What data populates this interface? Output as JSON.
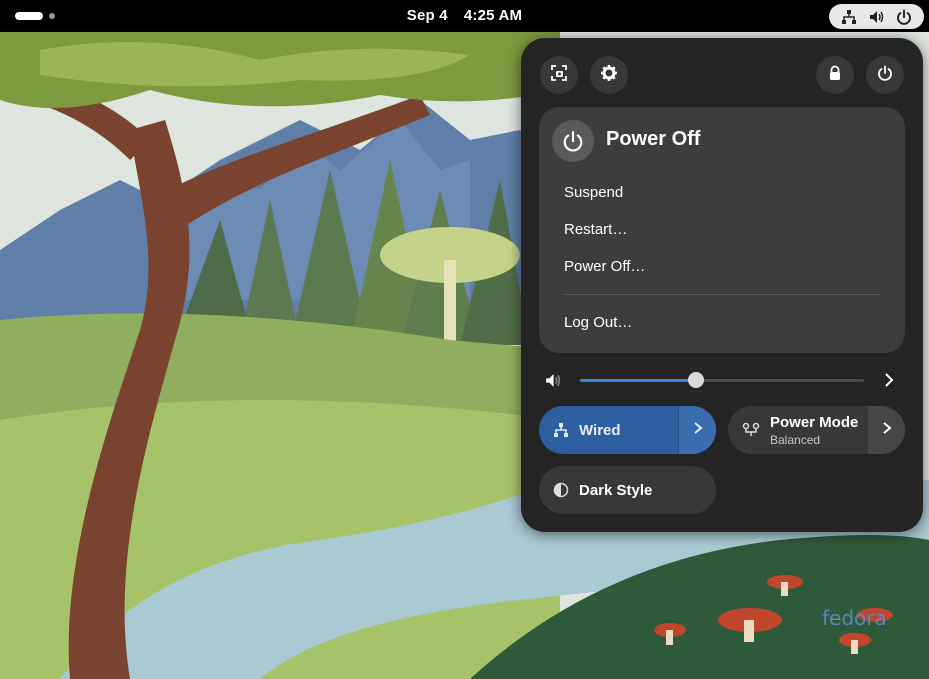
{
  "topbar": {
    "date": "Sep 4",
    "time": "4:25 AM",
    "tray_icons": [
      "network-wired-icon",
      "volume-icon",
      "power-icon"
    ]
  },
  "panel": {
    "header_buttons": {
      "left": [
        "screenshot-icon",
        "settings-gear-icon"
      ],
      "right": [
        "lock-icon",
        "power-icon"
      ]
    },
    "power_menu": {
      "title": "Power Off",
      "items": [
        "Suspend",
        "Restart…",
        "Power Off…"
      ],
      "logout": "Log Out…"
    },
    "volume": {
      "level": 0.41
    },
    "toggles": {
      "wired": {
        "label": "Wired",
        "active": true
      },
      "power_mode": {
        "label": "Power Mode",
        "subtitle": "Balanced",
        "active": false
      },
      "dark_style": {
        "label": "Dark Style",
        "active": false
      }
    }
  },
  "wallpaper": {
    "logo_text": "fedora"
  },
  "colors": {
    "accent": "#3584e4",
    "active_toggle": "#2c5ea0",
    "panel_bg": "#242424",
    "submenu_bg": "#3d3d3d",
    "button_bg": "#383838"
  }
}
